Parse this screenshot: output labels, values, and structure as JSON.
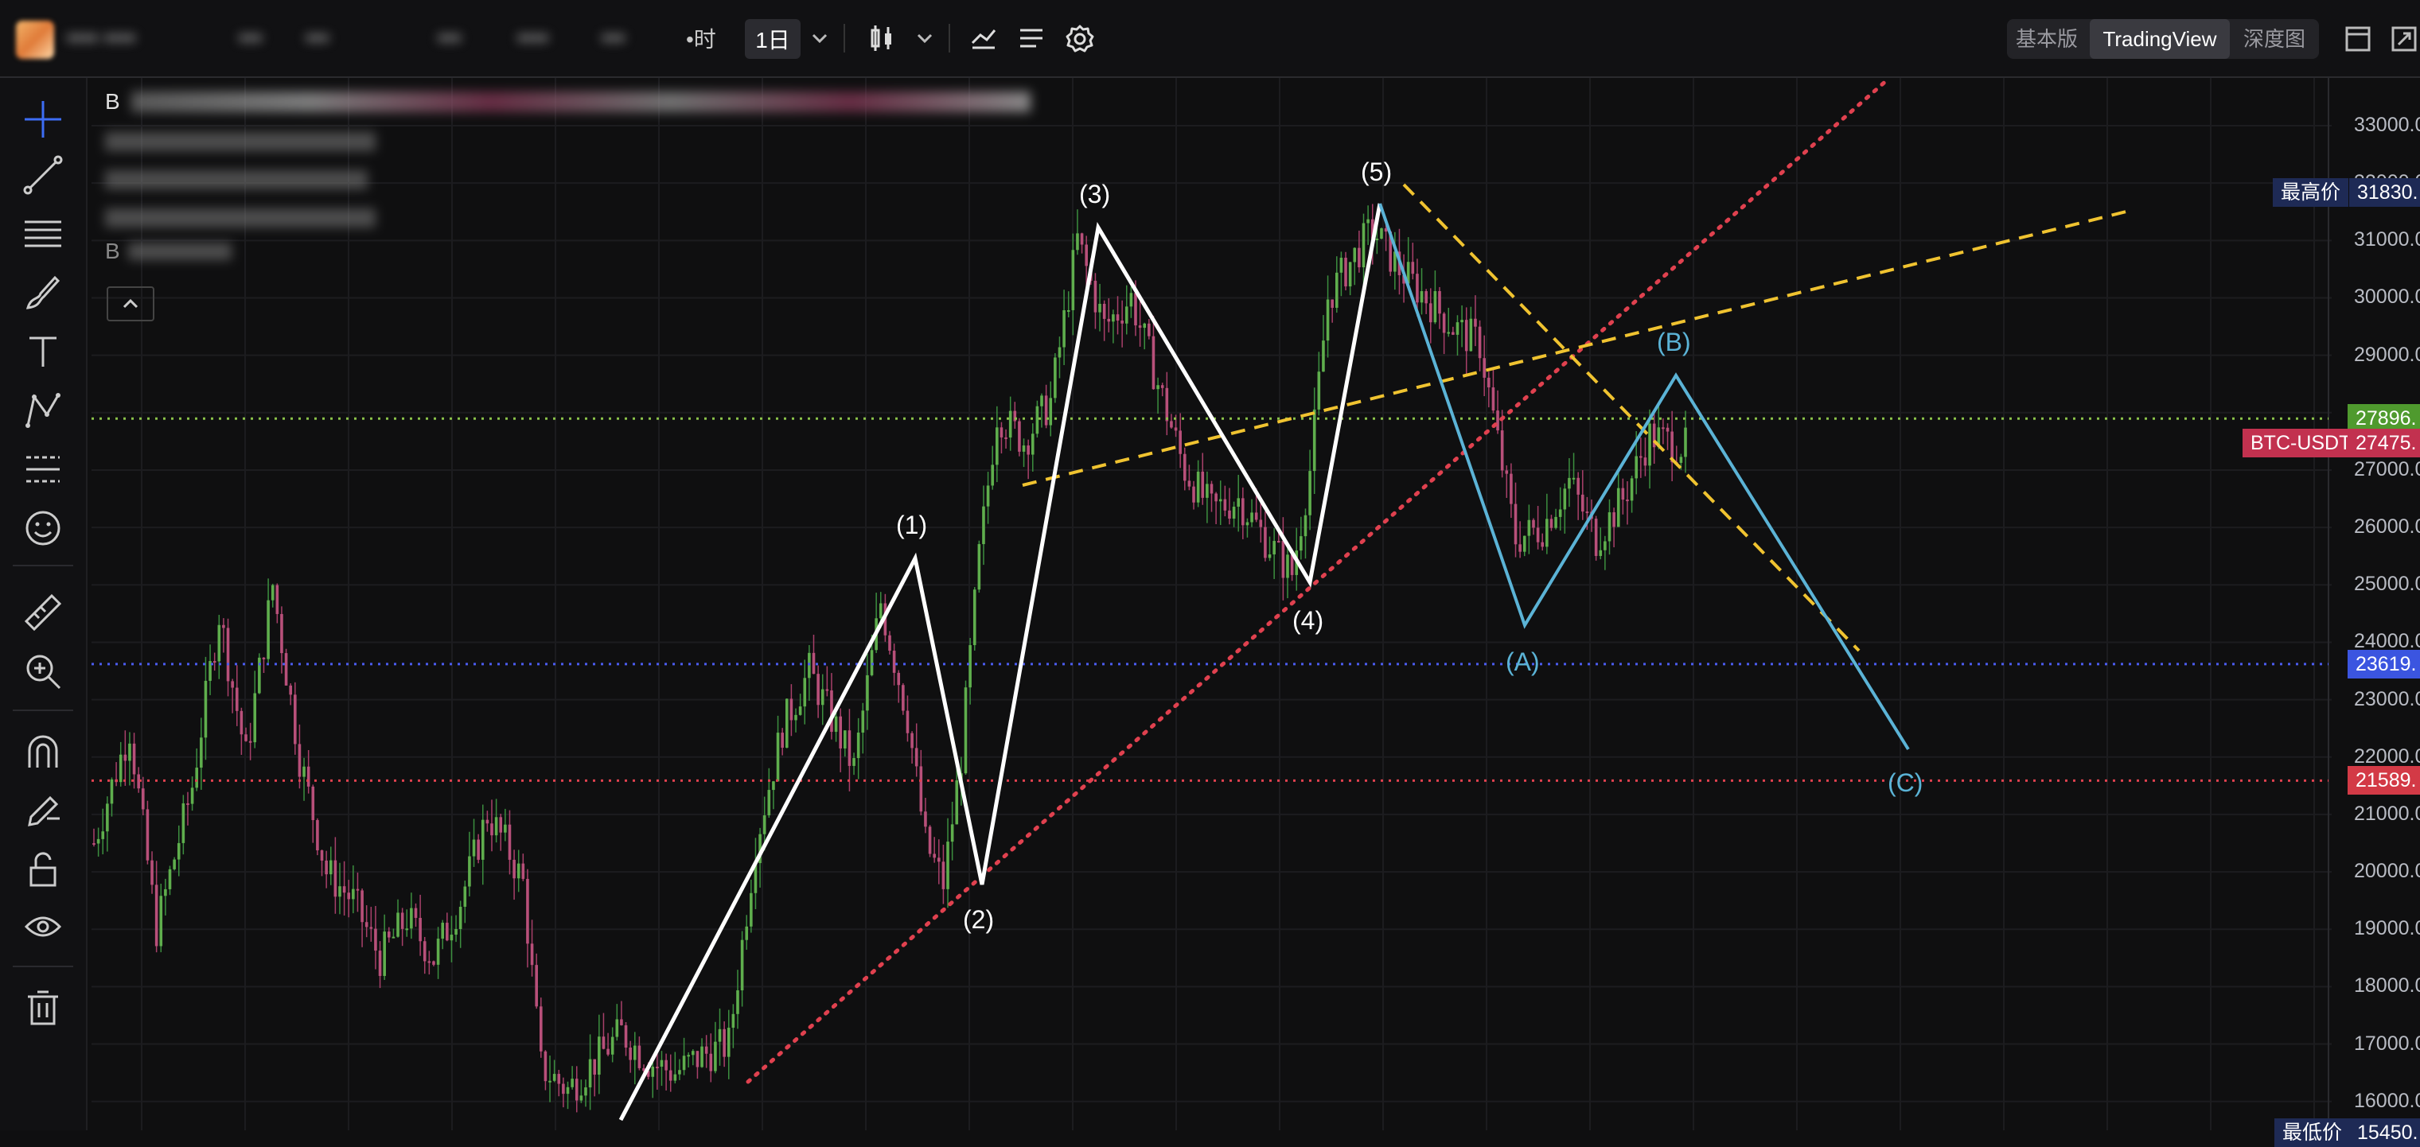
{
  "toolbar": {
    "timeframe": "1日",
    "blurred_items": [
      "•••• ••••",
      "•••",
      "•••",
      "•••",
      "••••",
      "•••",
      "•时"
    ],
    "views": [
      "基本版",
      "TradingView",
      "深度图"
    ],
    "active_view": "TradingView"
  },
  "legend": {
    "symbol_initial": "B",
    "row2_initial": "B"
  },
  "price_axis": {
    "labels": [
      "33000.0",
      "32000.0",
      "31000.0",
      "30000.0",
      "29000.0",
      "28000.0",
      "27000.0",
      "26000.0",
      "25000.0",
      "24000.0",
      "23000.0",
      "22000.0",
      "21000.0",
      "20000.0",
      "19000.0",
      "18000.0",
      "17000.0",
      "16000.0"
    ],
    "high_label": "最高价",
    "high_value": "31830.",
    "low_label": "最低价",
    "low_value": "15450.",
    "symbol": "BTC-USDT",
    "last_price": "27475.",
    "green_line": "27896.",
    "blue_line": "23619.",
    "red_line": "21589."
  },
  "waves": {
    "impulse": [
      "(1)",
      "(2)",
      "(3)",
      "(4)",
      "(5)"
    ],
    "correction": [
      "(A)",
      "(B)",
      "(C)"
    ]
  },
  "colors": {
    "up": "#26a69a",
    "down": "#c2437a",
    "wave_white": "#ffffff",
    "wave_cyan": "#5bb3d6",
    "yellow_dash": "#f0c330",
    "red_dot": "#e0414f",
    "green_dot": "#8bc34a",
    "blue_dot": "#4b5cf0"
  }
}
